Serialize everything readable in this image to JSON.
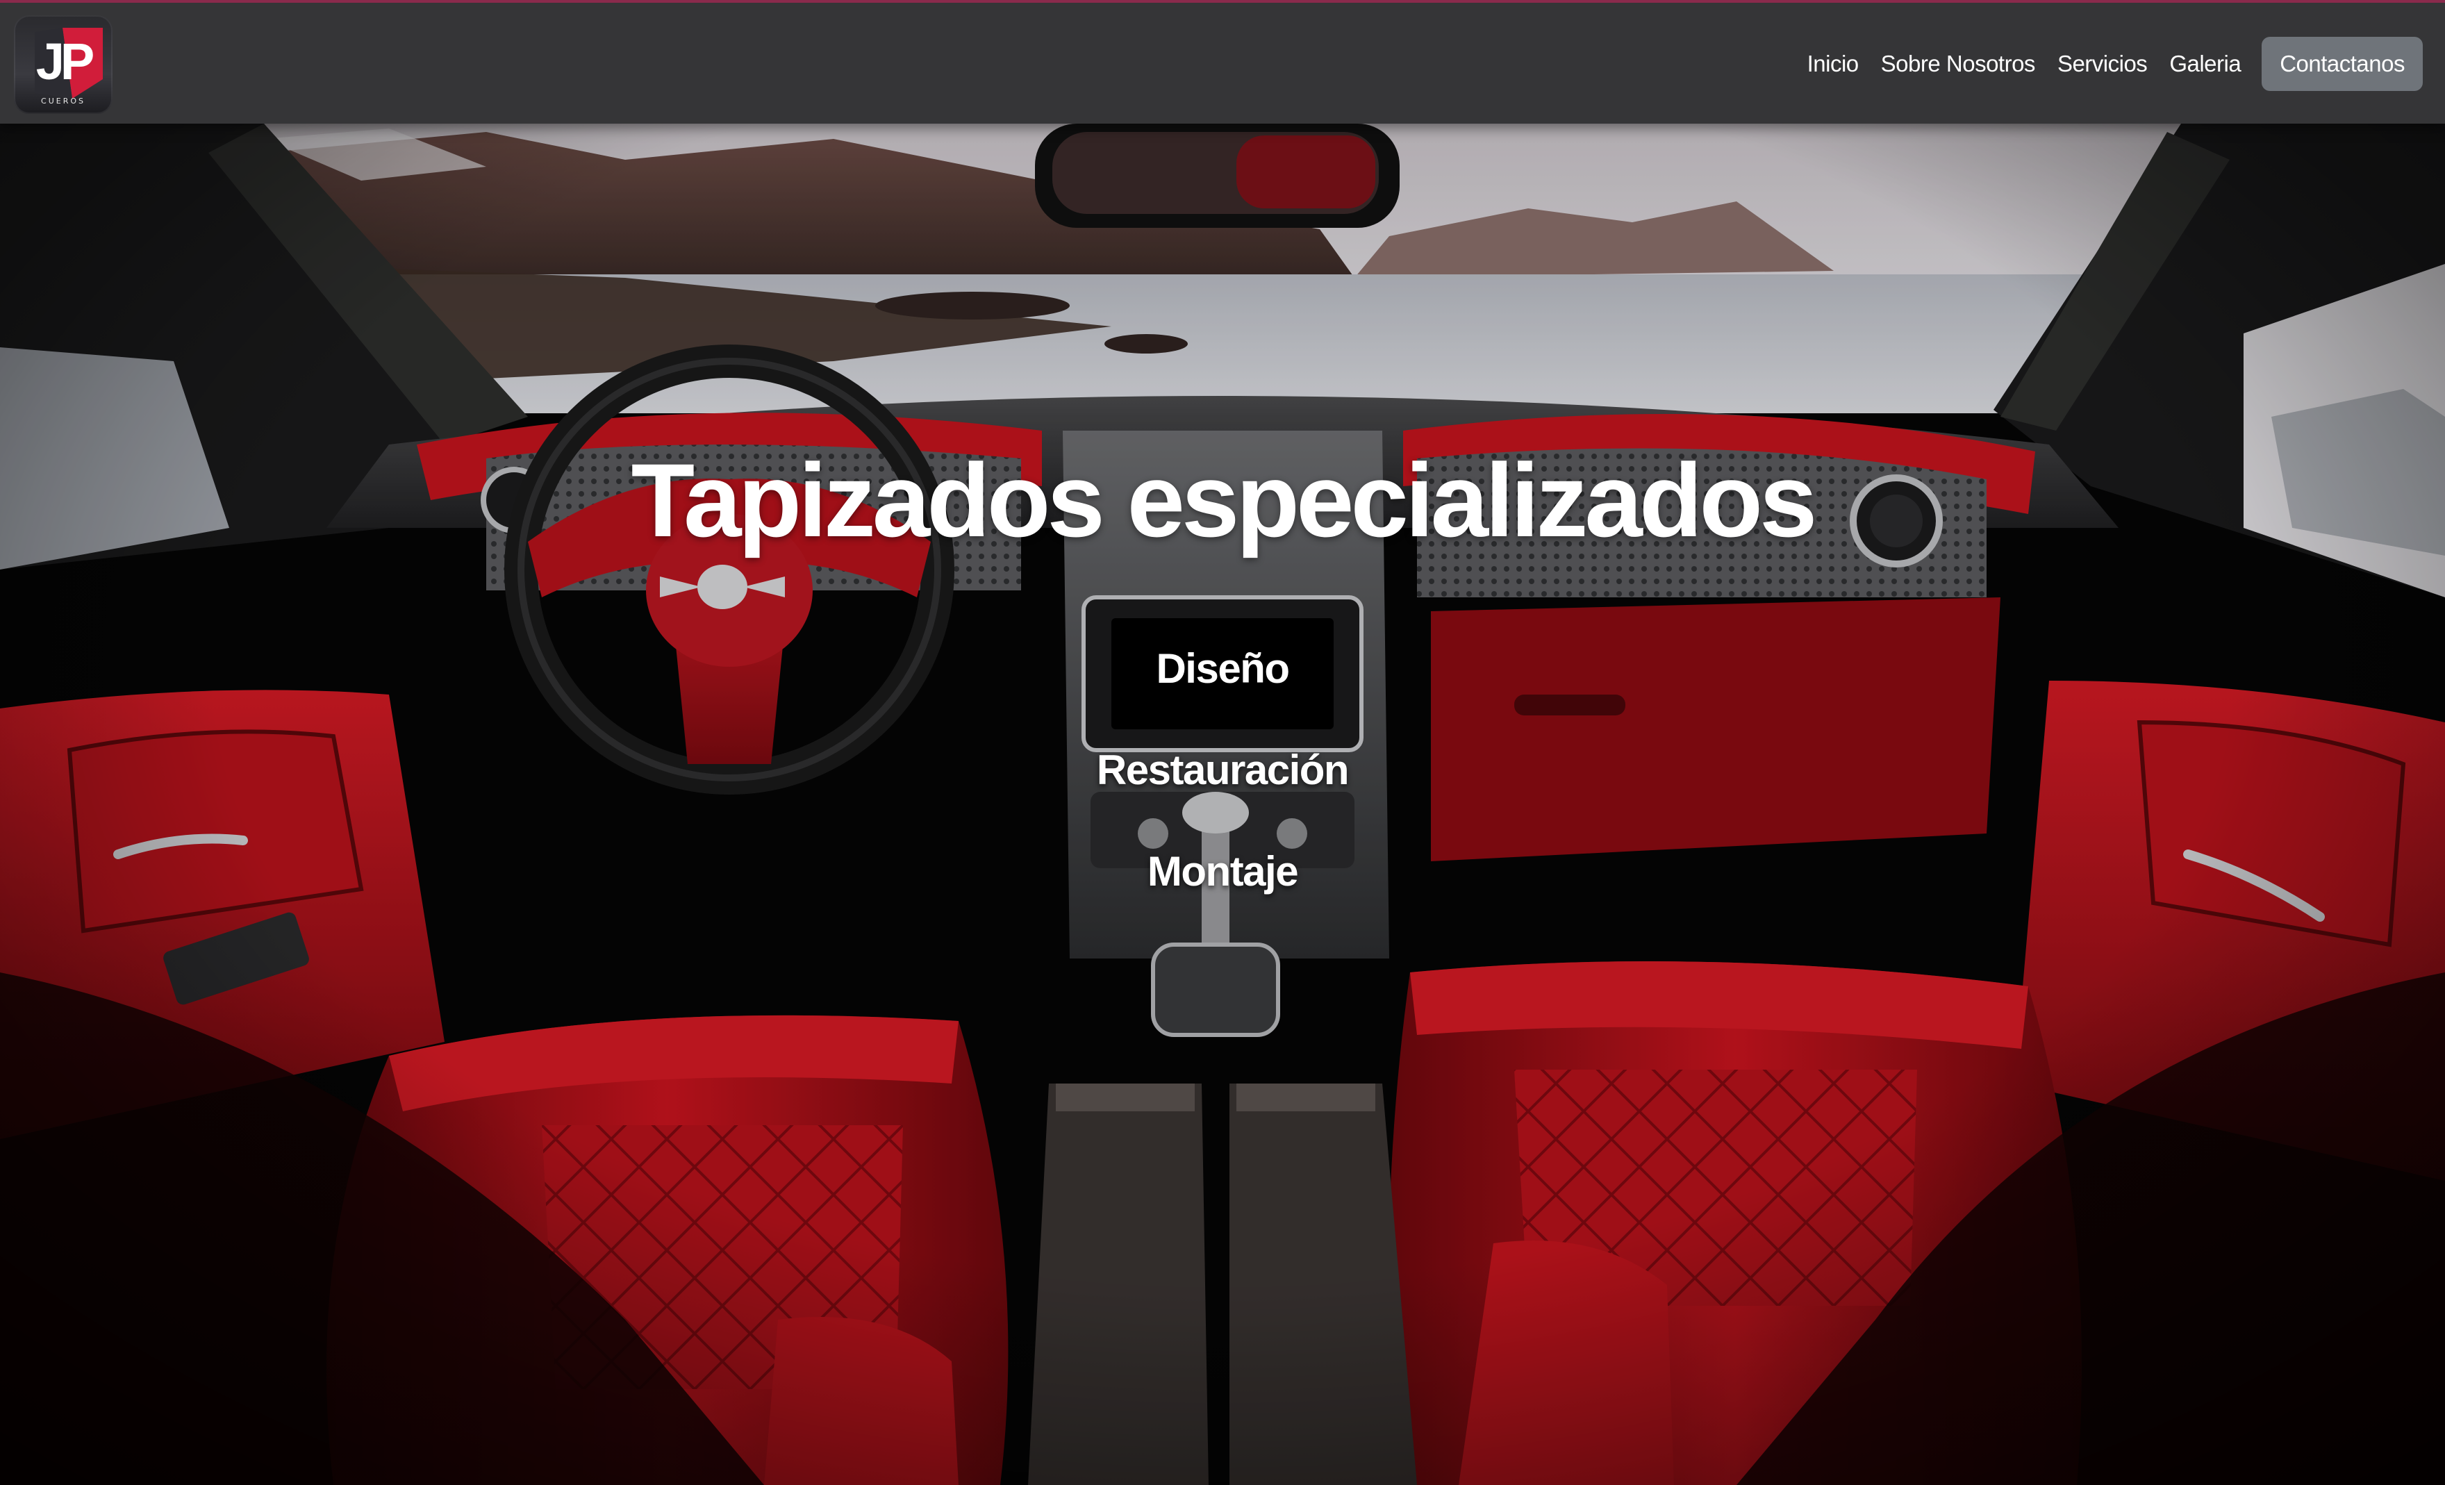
{
  "brand": {
    "logo_letters": "JP",
    "logo_subtext": "CUEROS"
  },
  "nav": {
    "links": [
      "Inicio",
      "Sobre Nosotros",
      "Servicios",
      "Galeria"
    ],
    "cta": "Contactanos"
  },
  "hero": {
    "title": "Tapizados especializados",
    "items": [
      "Diseño",
      "Restauración",
      "Montaje"
    ],
    "background_image": "luxury car interior with red leather seats"
  },
  "colors": {
    "navbar_bg": "#3a3a3c",
    "navbar_top_accent": "#8a2a4c",
    "cta_bg": "#6f747a",
    "leather_red": "#b3121c",
    "text": "#ffffff"
  },
  "icons": [
    "jp-cueros-logo-icon"
  ]
}
